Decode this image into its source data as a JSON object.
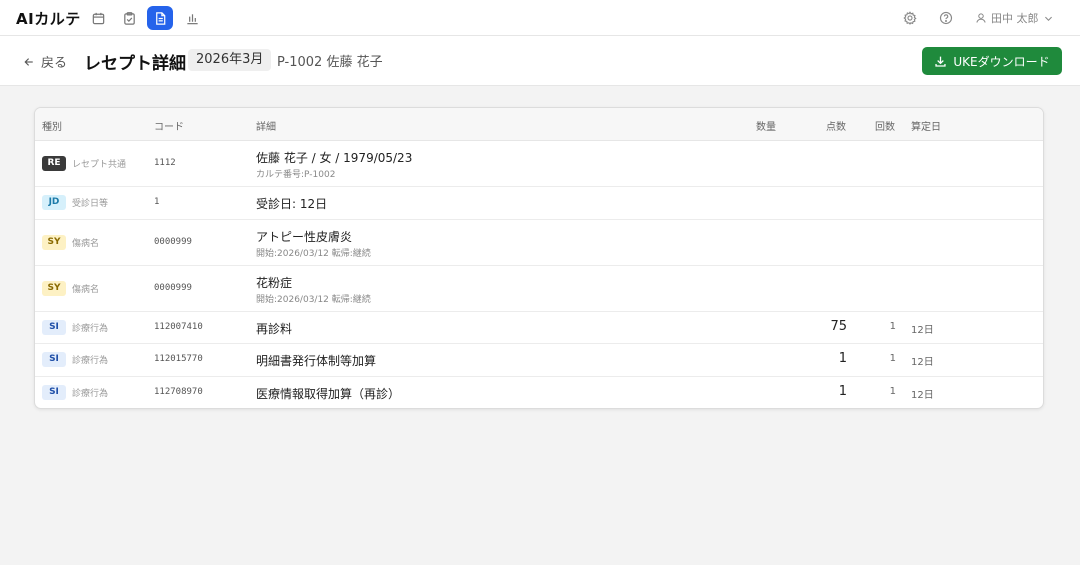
{
  "app": {
    "title": "AIカルテ"
  },
  "nav": {
    "icons": [
      "calendar-icon",
      "clipboard-check-icon",
      "document-icon",
      "bar-chart-icon"
    ],
    "active_index": 2
  },
  "user": {
    "name": "田中 太郎"
  },
  "header": {
    "back_label": "戻る",
    "title": "レセプト詳細",
    "period": "2026年3月",
    "patient": "P-1002 佐藤 花子",
    "download_label": "UKEダウンロード"
  },
  "table": {
    "headers": {
      "type": "種別",
      "code": "コード",
      "detail": "詳細",
      "qty": "数量",
      "points": "点数",
      "count": "回数",
      "date": "算定日"
    },
    "rows": [
      {
        "badge": "RE",
        "type": "レセプト共通",
        "code": "1112",
        "detail": "佐藤 花子 / 女 / 1979/05/23",
        "sub": "カルテ番号:P-1002",
        "points": "",
        "count": "",
        "date": ""
      },
      {
        "badge": "JD",
        "type": "受診日等",
        "code": "1",
        "detail": "受診日: 12日",
        "sub": "",
        "points": "",
        "count": "",
        "date": ""
      },
      {
        "badge": "SY",
        "type": "傷病名",
        "code": "0000999",
        "detail": "アトピー性皮膚炎",
        "sub": "開始:2026/03/12 転帰:継続",
        "points": "",
        "count": "",
        "date": ""
      },
      {
        "badge": "SY",
        "type": "傷病名",
        "code": "0000999",
        "detail": "花粉症",
        "sub": "開始:2026/03/12 転帰:継続",
        "points": "",
        "count": "",
        "date": ""
      },
      {
        "badge": "SI",
        "type": "診療行為",
        "code": "112007410",
        "detail": "再診料",
        "sub": "",
        "points": "75",
        "count": "1",
        "date": "12日"
      },
      {
        "badge": "SI",
        "type": "診療行為",
        "code": "112015770",
        "detail": "明細書発行体制等加算",
        "sub": "",
        "points": "1",
        "count": "1",
        "date": "12日"
      },
      {
        "badge": "SI",
        "type": "診療行為",
        "code": "112708970",
        "detail": "医療情報取得加算（再診）",
        "sub": "",
        "points": "1",
        "count": "1",
        "date": "12日"
      }
    ]
  },
  "colors": {
    "accent": "#2563eb",
    "download": "#1f8a3c",
    "badge_RE": "#3a3a3a",
    "badge_JD": "#d6f0fb",
    "badge_SY": "#fdf1c4",
    "badge_SI": "#e3edfb"
  }
}
